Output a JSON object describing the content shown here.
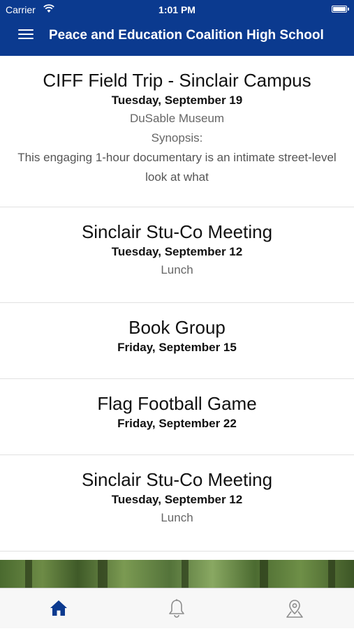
{
  "status_bar": {
    "carrier": "Carrier",
    "time": "1:01 PM"
  },
  "app_bar": {
    "title": "Peace and Education Coalition High School",
    "color": "#0b3a8f"
  },
  "events": [
    {
      "title": "CIFF Field Trip - Sinclair Campus",
      "date": "Tuesday, September 19",
      "location": "DuSable Museum",
      "synopsis_label": "Synopsis:",
      "description": "This engaging 1-hour documentary is an intimate street-level look at what"
    },
    {
      "title": "Sinclair Stu-Co Meeting",
      "date": "Tuesday, September 12",
      "location": "Lunch"
    },
    {
      "title": "Book Group",
      "date": "Friday, September 15"
    },
    {
      "title": "Flag Football Game",
      "date": "Friday, September 22"
    },
    {
      "title": "Sinclair Stu-Co Meeting",
      "date": "Tuesday, September 12",
      "location": "Lunch"
    }
  ],
  "tab_bar": {
    "tabs": [
      {
        "icon": "home-icon",
        "active": true
      },
      {
        "icon": "bell-icon",
        "active": false
      },
      {
        "icon": "map-pin-icon",
        "active": false
      }
    ],
    "active_color": "#0b3a8f",
    "inactive_color": "#8e8e8e"
  }
}
